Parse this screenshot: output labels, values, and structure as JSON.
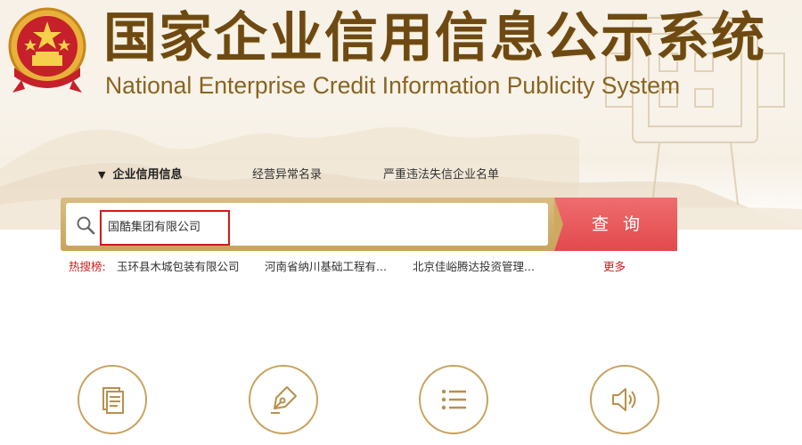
{
  "header": {
    "title_cn": "国家企业信用信息公示系统",
    "title_en": "National Enterprise Credit Information Publicity System",
    "emblem_icon": "national-emblem-icon"
  },
  "nav": {
    "tabs": [
      {
        "label": "企业信用信息",
        "active": true
      },
      {
        "label": "经营异常名录",
        "active": false
      },
      {
        "label": "严重违法失信企业名单",
        "active": false
      }
    ]
  },
  "search": {
    "value": "国酷集团有限公司",
    "button_label": "查询",
    "icon": "search-icon"
  },
  "hot_searches": {
    "label": "热搜榜:",
    "items": [
      "玉环县木城包装有限公司",
      "河南省纳川基础工程有...",
      "北京佳峪腾达投资管理..."
    ],
    "more_label": "更多"
  },
  "features": [
    {
      "icon": "document-icon"
    },
    {
      "icon": "pen-icon"
    },
    {
      "icon": "list-icon"
    },
    {
      "icon": "speaker-icon"
    }
  ],
  "colors": {
    "brand_brown": "#6e4a12",
    "gold": "#c8a25f",
    "search_button_red": "#e2494d",
    "highlight_red": "#d11a1a"
  }
}
